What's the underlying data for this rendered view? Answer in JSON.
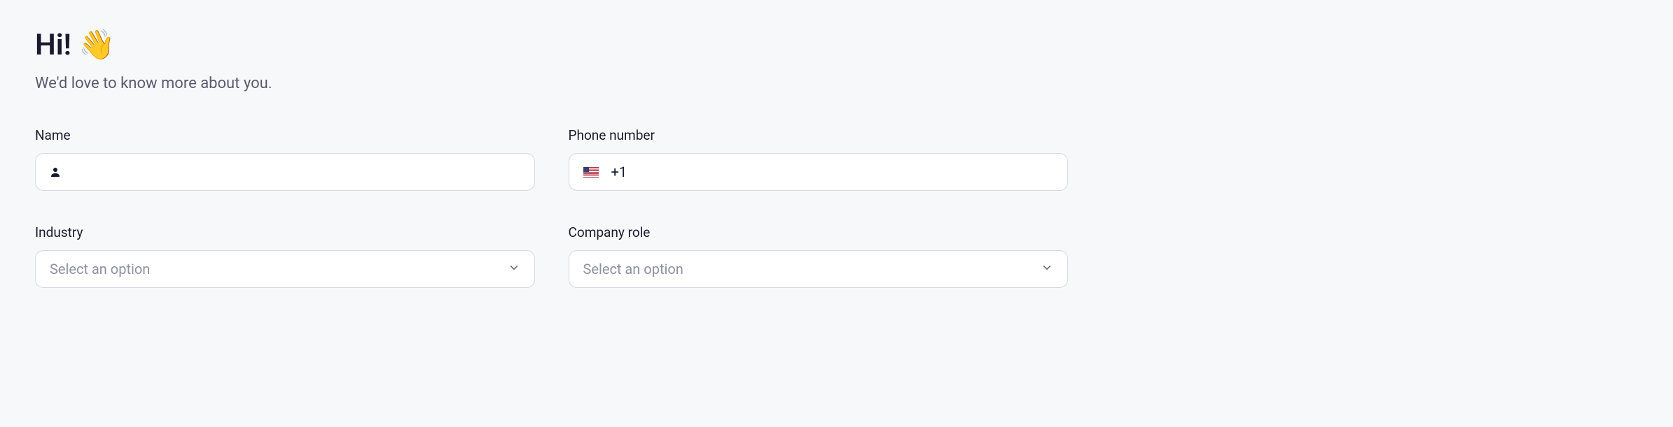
{
  "heading": "Hi! 👋",
  "subtitle": "We'd love to know more about you.",
  "fields": {
    "name": {
      "label": "Name",
      "value": "",
      "placeholder": ""
    },
    "phone": {
      "label": "Phone number",
      "prefix": "+1",
      "value": "",
      "placeholder": ""
    },
    "industry": {
      "label": "Industry",
      "placeholder": "Select an option"
    },
    "role": {
      "label": "Company role",
      "placeholder": "Select an option"
    }
  }
}
